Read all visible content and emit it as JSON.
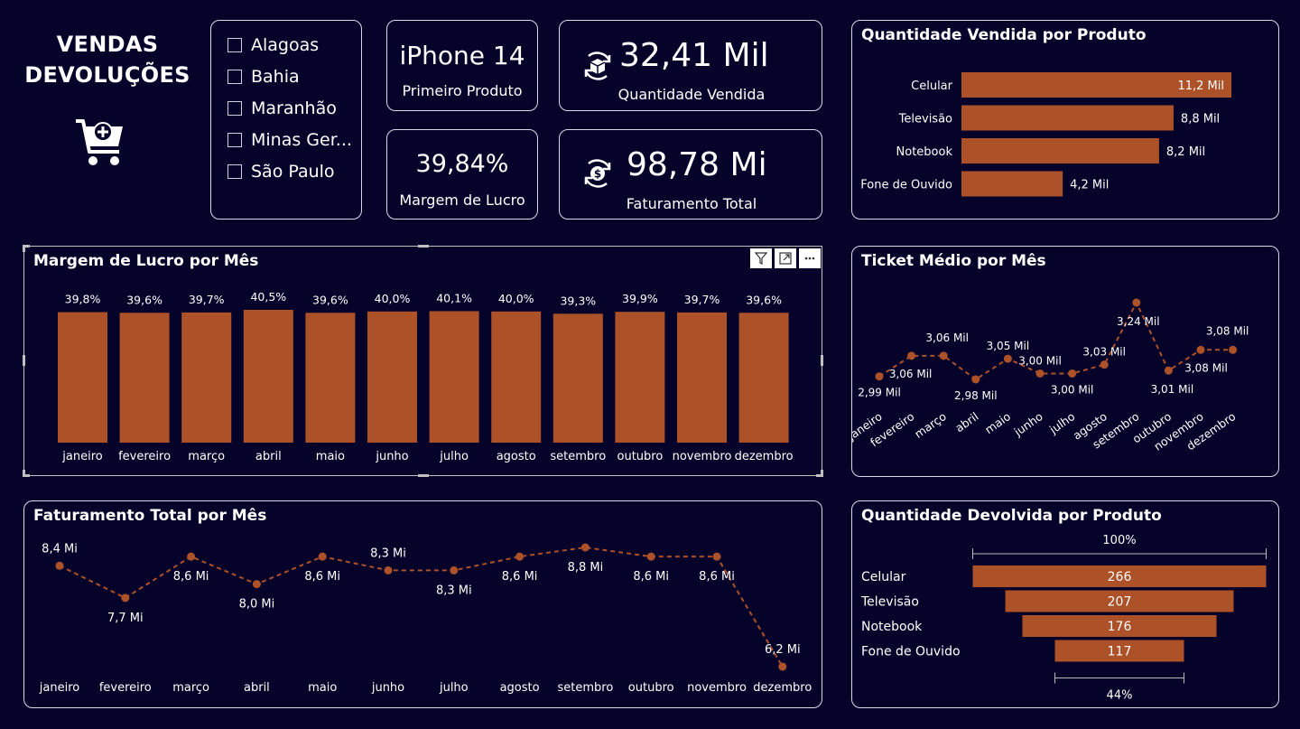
{
  "header": {
    "title_line1": "VENDAS",
    "title_line2": "DEVOLUÇÕES",
    "icon": "cart-plus-icon"
  },
  "slicer": {
    "items": [
      "Alagoas",
      "Bahia",
      "Maranhão",
      "Minas Ger...",
      "São Paulo"
    ]
  },
  "kpis": {
    "produto": {
      "value": "iPhone 14",
      "label": "Primeiro Produto"
    },
    "margem": {
      "value": "39,84%",
      "label": "Margem de Lucro"
    },
    "quantidade": {
      "value": "32,41 Mil",
      "label": "Quantidade Vendida",
      "icon": "box-refresh-icon"
    },
    "faturamento": {
      "value": "98,78 Mi",
      "label": "Faturamento Total",
      "icon": "dollar-refresh-icon"
    }
  },
  "colors": {
    "background": "#05032a",
    "bar": "#ad5129",
    "text": "#ffffff",
    "border": "#d9d9e8"
  },
  "qtd_vendida": {
    "title": "Quantidade Vendida por Produto",
    "chart_data": {
      "type": "bar",
      "orientation": "horizontal",
      "categories": [
        "Celular",
        "Televisão",
        "Notebook",
        "Fone de Ouvido"
      ],
      "values": [
        11.2,
        8.8,
        8.2,
        4.2
      ],
      "labels": [
        "11,2 Mil",
        "8,8 Mil",
        "8,2 Mil",
        "4,2 Mil"
      ],
      "xlim": [
        0,
        11.2
      ]
    }
  },
  "margem_mes": {
    "title": "Margem de Lucro por Mês",
    "chart_data": {
      "type": "bar",
      "categories": [
        "janeiro",
        "fevereiro",
        "março",
        "abril",
        "maio",
        "junho",
        "julho",
        "agosto",
        "setembro",
        "outubro",
        "novembro",
        "dezembro"
      ],
      "values": [
        39.8,
        39.6,
        39.7,
        40.5,
        39.6,
        40.0,
        40.1,
        40.0,
        39.3,
        39.9,
        39.7,
        39.6
      ],
      "labels": [
        "39,8%",
        "39,6%",
        "39,7%",
        "40,5%",
        "39,6%",
        "40,0%",
        "40,1%",
        "40,0%",
        "39,3%",
        "39,9%",
        "39,7%",
        "39,6%"
      ],
      "ylim": [
        0,
        40.5
      ]
    }
  },
  "ticket_mes": {
    "title": "Ticket Médio por Mês",
    "chart_data": {
      "type": "line",
      "categories": [
        "janeiro",
        "fevereiro",
        "março",
        "abril",
        "maio",
        "junho",
        "julho",
        "agosto",
        "setembro",
        "outubro",
        "novembro",
        "dezembro"
      ],
      "values": [
        2.99,
        3.06,
        3.06,
        2.98,
        3.05,
        3.0,
        3.0,
        3.03,
        3.24,
        3.01,
        3.08,
        3.08
      ],
      "labels": [
        "2,99 Mil",
        "3,06 Mil",
        "3,06 Mil",
        "2,98 Mil",
        "3,05 Mil",
        "3,00 Mil",
        "3,00 Mil",
        "3,03 Mil",
        "3,24 Mil",
        "3,01 Mil",
        "3,08 Mil",
        "3,08 Mil"
      ]
    }
  },
  "faturamento_mes": {
    "title": "Faturamento Total por Mês",
    "chart_data": {
      "type": "line",
      "categories": [
        "janeiro",
        "fevereiro",
        "março",
        "abril",
        "maio",
        "junho",
        "julho",
        "agosto",
        "setembro",
        "outubro",
        "novembro",
        "dezembro"
      ],
      "values": [
        8.4,
        7.7,
        8.6,
        8.0,
        8.6,
        8.3,
        8.3,
        8.6,
        8.8,
        8.6,
        8.6,
        6.2
      ],
      "labels": [
        "8,4 Mi",
        "7,7 Mi",
        "8,6 Mi",
        "8,0 Mi",
        "8,6 Mi",
        "8,3 Mi",
        "8,3 Mi",
        "8,6 Mi",
        "8,8 Mi",
        "8,6 Mi",
        "8,6 Mi",
        "6,2 Mi"
      ]
    }
  },
  "qtd_devolvida": {
    "title": "Quantidade Devolvida por Produto",
    "chart_data": {
      "type": "funnel",
      "categories": [
        "Celular",
        "Televisão",
        "Notebook",
        "Fone de Ouvido"
      ],
      "values": [
        266,
        207,
        176,
        117
      ],
      "top_label": "100%",
      "bottom_label": "44%"
    }
  }
}
